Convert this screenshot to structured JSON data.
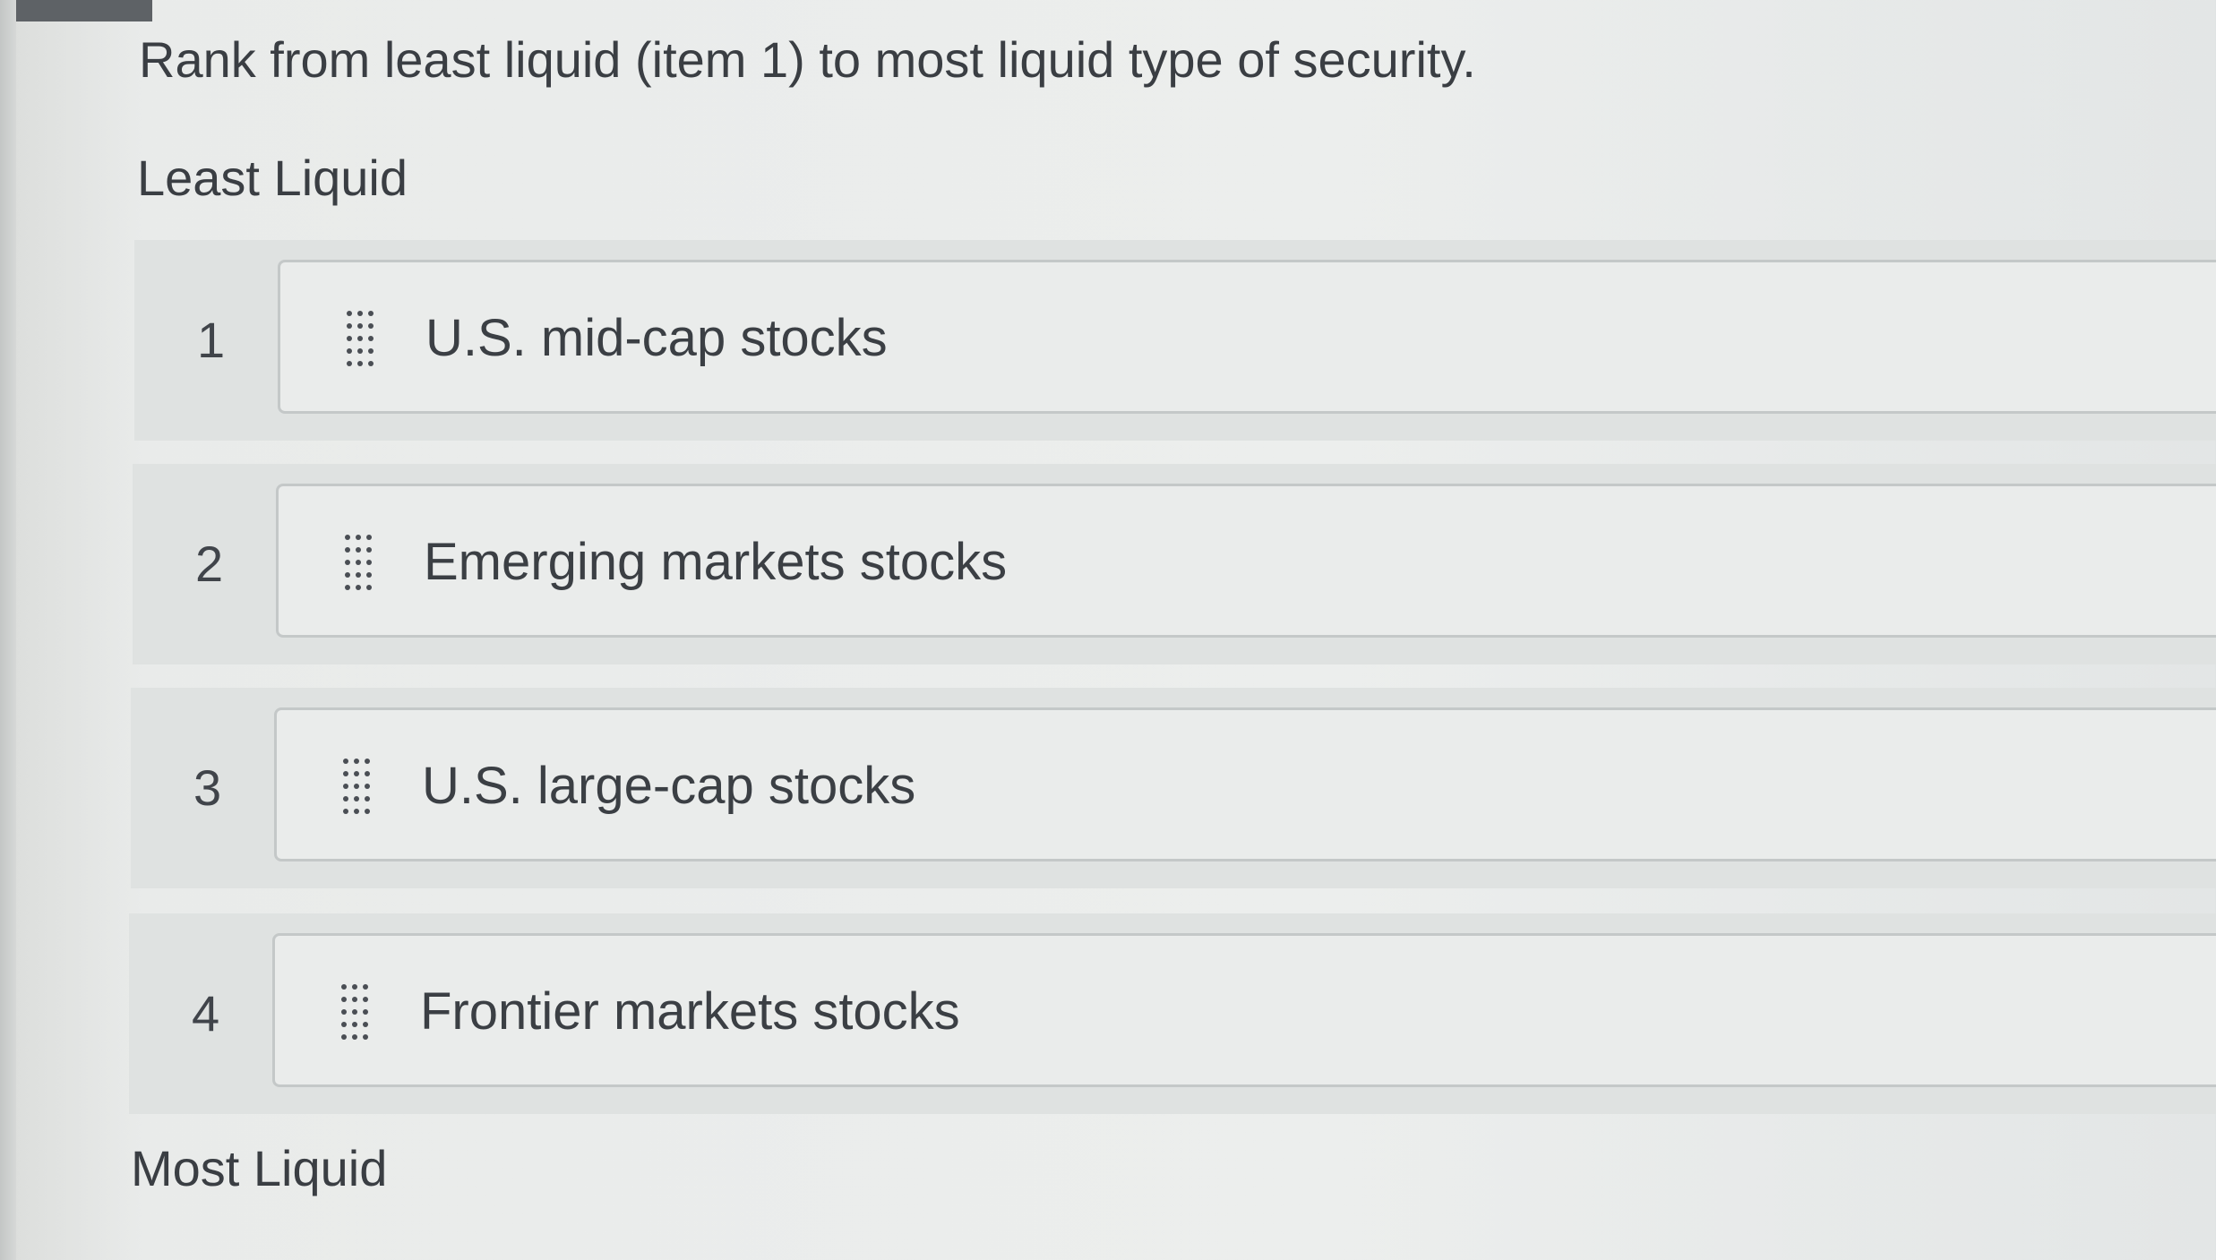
{
  "question": "Rank from least liquid (item 1) to most liquid type of security.",
  "labels": {
    "top": "Least Liquid",
    "bottom": "Most Liquid"
  },
  "items": [
    {
      "rank": "1",
      "text": "U.S. mid-cap stocks"
    },
    {
      "rank": "2",
      "text": "Emerging markets stocks"
    },
    {
      "rank": "3",
      "text": "U.S. large-cap stocks"
    },
    {
      "rank": "4",
      "text": "Frontier markets stocks"
    }
  ],
  "icons": {
    "drag_handle": "drag-handle-icon"
  },
  "colors": {
    "background": "#eceeed",
    "row": "#dfe2e1",
    "card": "#eaeceb",
    "card_border": "#c4c8c8",
    "text": "#3b3f44"
  }
}
